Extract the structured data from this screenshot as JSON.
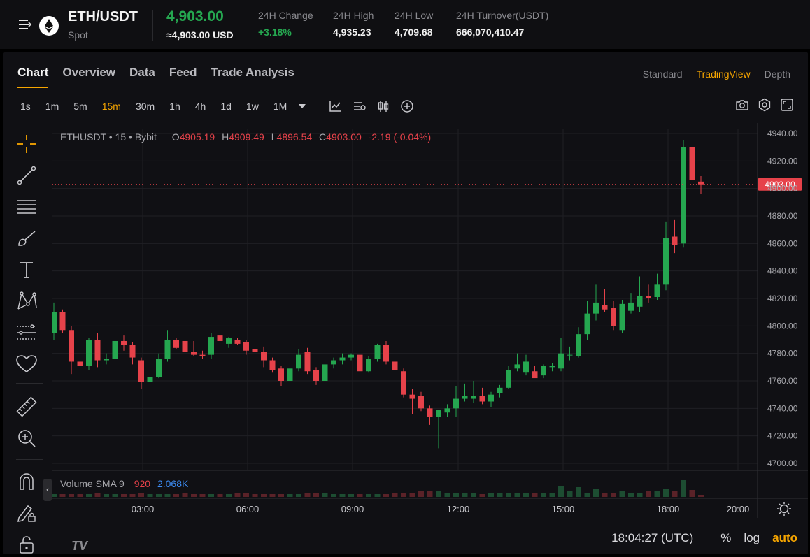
{
  "ticker": {
    "pair": "ETH/USDT",
    "type": "Spot",
    "last_price": "4,903.00",
    "last_price_usd": "≈4,903.00 USD",
    "stats": [
      {
        "label": "24H Change",
        "value": "+3.18%"
      },
      {
        "label": "24H High",
        "value": "4,935.23"
      },
      {
        "label": "24H Low",
        "value": "4,709.68"
      },
      {
        "label": "24H Turnover(USDT)",
        "value": "666,070,410.47"
      }
    ]
  },
  "tabs": [
    "Chart",
    "Overview",
    "Data",
    "Feed",
    "Trade Analysis"
  ],
  "active_tab": "Chart",
  "views": [
    "Standard",
    "TradingView",
    "Depth"
  ],
  "active_view": "TradingView",
  "intervals": [
    "1s",
    "1m",
    "5m",
    "15m",
    "30m",
    "1h",
    "4h",
    "1d",
    "1w",
    "1M"
  ],
  "active_interval": "15m",
  "legend": {
    "symbol": "ETHUSDT",
    "interval": "15",
    "exchange": "Bybit",
    "o_label": "O",
    "o": "4905.19",
    "h_label": "H",
    "h": "4909.49",
    "l_label": "L",
    "l": "4896.54",
    "c_label": "C",
    "c": "4903.00",
    "change": "-2.19 (-0.04%)"
  },
  "volume_legend": {
    "title": "Volume SMA 9",
    "value": "920",
    "sma": "2.068K"
  },
  "price_label": "4903.00",
  "bottom": {
    "time": "18:04:27 (UTC)",
    "percent": "%",
    "log": "log",
    "auto": "auto"
  },
  "colors": {
    "up": "#25a750",
    "down": "#e6424a",
    "accent": "#f7a600",
    "background": "#101014"
  },
  "icons": {
    "left_toolbar": [
      "crosshair-icon",
      "trend-line-icon",
      "horizontal-lines-icon",
      "brush-icon",
      "text-icon",
      "pattern-icon",
      "prediction-icon",
      "favorites-icon",
      "ruler-icon",
      "zoom-in-icon",
      "magnet-icon",
      "lock-drawing-icon",
      "lock-icon"
    ],
    "top_right": [
      "camera-icon",
      "settings-icon",
      "fullscreen-icon"
    ]
  },
  "chart_data": {
    "type": "candlestick",
    "ylim": [
      4700,
      4940
    ],
    "yticks": [
      "4940.00",
      "4920.00",
      "4900.00",
      "4880.00",
      "4860.00",
      "4840.00",
      "4820.00",
      "4800.00",
      "4780.00",
      "4760.00",
      "4740.00",
      "4720.00",
      "4700.00"
    ],
    "xticks": [
      "03:00",
      "06:00",
      "09:00",
      "12:00",
      "15:00",
      "18:00",
      "20:00"
    ],
    "current_price": 4903.0,
    "candles": [
      {
        "o": 4795,
        "h": 4817,
        "l": 4790,
        "c": 4810
      },
      {
        "o": 4810,
        "h": 4812,
        "l": 4795,
        "c": 4797
      },
      {
        "o": 4797,
        "h": 4800,
        "l": 4765,
        "c": 4774
      },
      {
        "o": 4774,
        "h": 4783,
        "l": 4760,
        "c": 4771
      },
      {
        "o": 4771,
        "h": 4791,
        "l": 4768,
        "c": 4790
      },
      {
        "o": 4790,
        "h": 4795,
        "l": 4770,
        "c": 4775
      },
      {
        "o": 4775,
        "h": 4780,
        "l": 4772,
        "c": 4776
      },
      {
        "o": 4776,
        "h": 4791,
        "l": 4774,
        "c": 4789
      },
      {
        "o": 4789,
        "h": 4793,
        "l": 4782,
        "c": 4786
      },
      {
        "o": 4786,
        "h": 4788,
        "l": 4772,
        "c": 4777
      },
      {
        "o": 4775,
        "h": 4777,
        "l": 4754,
        "c": 4759
      },
      {
        "o": 4759,
        "h": 4767,
        "l": 4757,
        "c": 4763
      },
      {
        "o": 4763,
        "h": 4780,
        "l": 4762,
        "c": 4776
      },
      {
        "o": 4776,
        "h": 4797,
        "l": 4774,
        "c": 4790
      },
      {
        "o": 4790,
        "h": 4791,
        "l": 4783,
        "c": 4784
      },
      {
        "o": 4789,
        "h": 4793,
        "l": 4779,
        "c": 4781
      },
      {
        "o": 4781,
        "h": 4789,
        "l": 4778,
        "c": 4779
      },
      {
        "o": 4779,
        "h": 4782,
        "l": 4776,
        "c": 4778
      },
      {
        "o": 4779,
        "h": 4795,
        "l": 4776,
        "c": 4792
      },
      {
        "o": 4793,
        "h": 4795,
        "l": 4785,
        "c": 4789
      },
      {
        "o": 4787,
        "h": 4792,
        "l": 4784,
        "c": 4791
      },
      {
        "o": 4790,
        "h": 4791,
        "l": 4786,
        "c": 4787
      },
      {
        "o": 4788,
        "h": 4790,
        "l": 4779,
        "c": 4782
      },
      {
        "o": 4783,
        "h": 4786,
        "l": 4780,
        "c": 4781
      },
      {
        "o": 4781,
        "h": 4785,
        "l": 4770,
        "c": 4775
      },
      {
        "o": 4775,
        "h": 4777,
        "l": 4766,
        "c": 4768
      },
      {
        "o": 4769,
        "h": 4771,
        "l": 4756,
        "c": 4760
      },
      {
        "o": 4760,
        "h": 4771,
        "l": 4758,
        "c": 4769
      },
      {
        "o": 4769,
        "h": 4783,
        "l": 4767,
        "c": 4779
      },
      {
        "o": 4781,
        "h": 4784,
        "l": 4765,
        "c": 4767
      },
      {
        "o": 4768,
        "h": 4770,
        "l": 4757,
        "c": 4760
      },
      {
        "o": 4760,
        "h": 4774,
        "l": 4746,
        "c": 4772
      },
      {
        "o": 4772,
        "h": 4777,
        "l": 4769,
        "c": 4775
      },
      {
        "o": 4775,
        "h": 4780,
        "l": 4772,
        "c": 4777
      },
      {
        "o": 4777,
        "h": 4780,
        "l": 4775,
        "c": 4779
      },
      {
        "o": 4779,
        "h": 4781,
        "l": 4766,
        "c": 4767
      },
      {
        "o": 4767,
        "h": 4778,
        "l": 4766,
        "c": 4776
      },
      {
        "o": 4776,
        "h": 4787,
        "l": 4774,
        "c": 4786
      },
      {
        "o": 4786,
        "h": 4789,
        "l": 4772,
        "c": 4774
      },
      {
        "o": 4774,
        "h": 4776,
        "l": 4765,
        "c": 4768
      },
      {
        "o": 4767,
        "h": 4769,
        "l": 4748,
        "c": 4750
      },
      {
        "o": 4750,
        "h": 4754,
        "l": 4736,
        "c": 4747
      },
      {
        "o": 4749,
        "h": 4752,
        "l": 4738,
        "c": 4740
      },
      {
        "o": 4740,
        "h": 4742,
        "l": 4728,
        "c": 4734
      },
      {
        "o": 4734,
        "h": 4736,
        "l": 4711,
        "c": 4739
      },
      {
        "o": 4737,
        "h": 4743,
        "l": 4734,
        "c": 4740
      },
      {
        "o": 4740,
        "h": 4756,
        "l": 4734,
        "c": 4747
      },
      {
        "o": 4747,
        "h": 4758,
        "l": 4745,
        "c": 4749
      },
      {
        "o": 4747,
        "h": 4760,
        "l": 4744,
        "c": 4749
      },
      {
        "o": 4749,
        "h": 4755,
        "l": 4743,
        "c": 4745
      },
      {
        "o": 4745,
        "h": 4752,
        "l": 4741,
        "c": 4750
      },
      {
        "o": 4751,
        "h": 4757,
        "l": 4748,
        "c": 4755
      },
      {
        "o": 4755,
        "h": 4771,
        "l": 4754,
        "c": 4768
      },
      {
        "o": 4769,
        "h": 4780,
        "l": 4767,
        "c": 4772
      },
      {
        "o": 4766,
        "h": 4779,
        "l": 4764,
        "c": 4774
      },
      {
        "o": 4767,
        "h": 4771,
        "l": 4763,
        "c": 4762
      },
      {
        "o": 4764,
        "h": 4772,
        "l": 4762,
        "c": 4771
      },
      {
        "o": 4770,
        "h": 4773,
        "l": 4767,
        "c": 4771
      },
      {
        "o": 4769,
        "h": 4791,
        "l": 4767,
        "c": 4780
      },
      {
        "o": 4779,
        "h": 4785,
        "l": 4775,
        "c": 4779
      },
      {
        "o": 4778,
        "h": 4799,
        "l": 4777,
        "c": 4794
      },
      {
        "o": 4794,
        "h": 4818,
        "l": 4790,
        "c": 4809
      },
      {
        "o": 4809,
        "h": 4830,
        "l": 4804,
        "c": 4817
      },
      {
        "o": 4815,
        "h": 4827,
        "l": 4810,
        "c": 4812
      },
      {
        "o": 4813,
        "h": 4818,
        "l": 4797,
        "c": 4800
      },
      {
        "o": 4797,
        "h": 4819,
        "l": 4795,
        "c": 4816
      },
      {
        "o": 4811,
        "h": 4824,
        "l": 4809,
        "c": 4817
      },
      {
        "o": 4814,
        "h": 4836,
        "l": 4810,
        "c": 4822
      },
      {
        "o": 4822,
        "h": 4830,
        "l": 4817,
        "c": 4820
      },
      {
        "o": 4821,
        "h": 4838,
        "l": 4819,
        "c": 4830
      },
      {
        "o": 4830,
        "h": 4876,
        "l": 4826,
        "c": 4864
      },
      {
        "o": 4865,
        "h": 4877,
        "l": 4853,
        "c": 4859
      },
      {
        "o": 4860,
        "h": 4935,
        "l": 4857,
        "c": 4930
      },
      {
        "o": 4930,
        "h": 4931,
        "l": 4887,
        "c": 4906
      },
      {
        "o": 4905,
        "h": 4909,
        "l": 4896,
        "c": 4903
      }
    ],
    "volume": [
      2,
      2,
      2,
      2,
      2,
      3,
      2,
      2,
      2,
      2,
      3,
      2,
      2,
      2,
      2,
      3,
      2,
      2,
      2,
      2,
      2,
      3,
      3,
      2,
      2,
      2,
      2,
      2,
      2,
      3,
      3,
      3,
      2,
      2,
      2,
      2,
      2,
      2,
      2,
      3,
      3,
      3,
      4,
      4,
      4,
      3,
      3,
      3,
      3,
      2,
      3,
      3,
      3,
      3,
      3,
      3,
      3,
      3,
      8,
      4,
      7,
      3,
      6,
      3,
      3,
      4,
      3,
      3,
      4,
      4,
      6,
      4,
      12,
      5,
      1
    ]
  }
}
